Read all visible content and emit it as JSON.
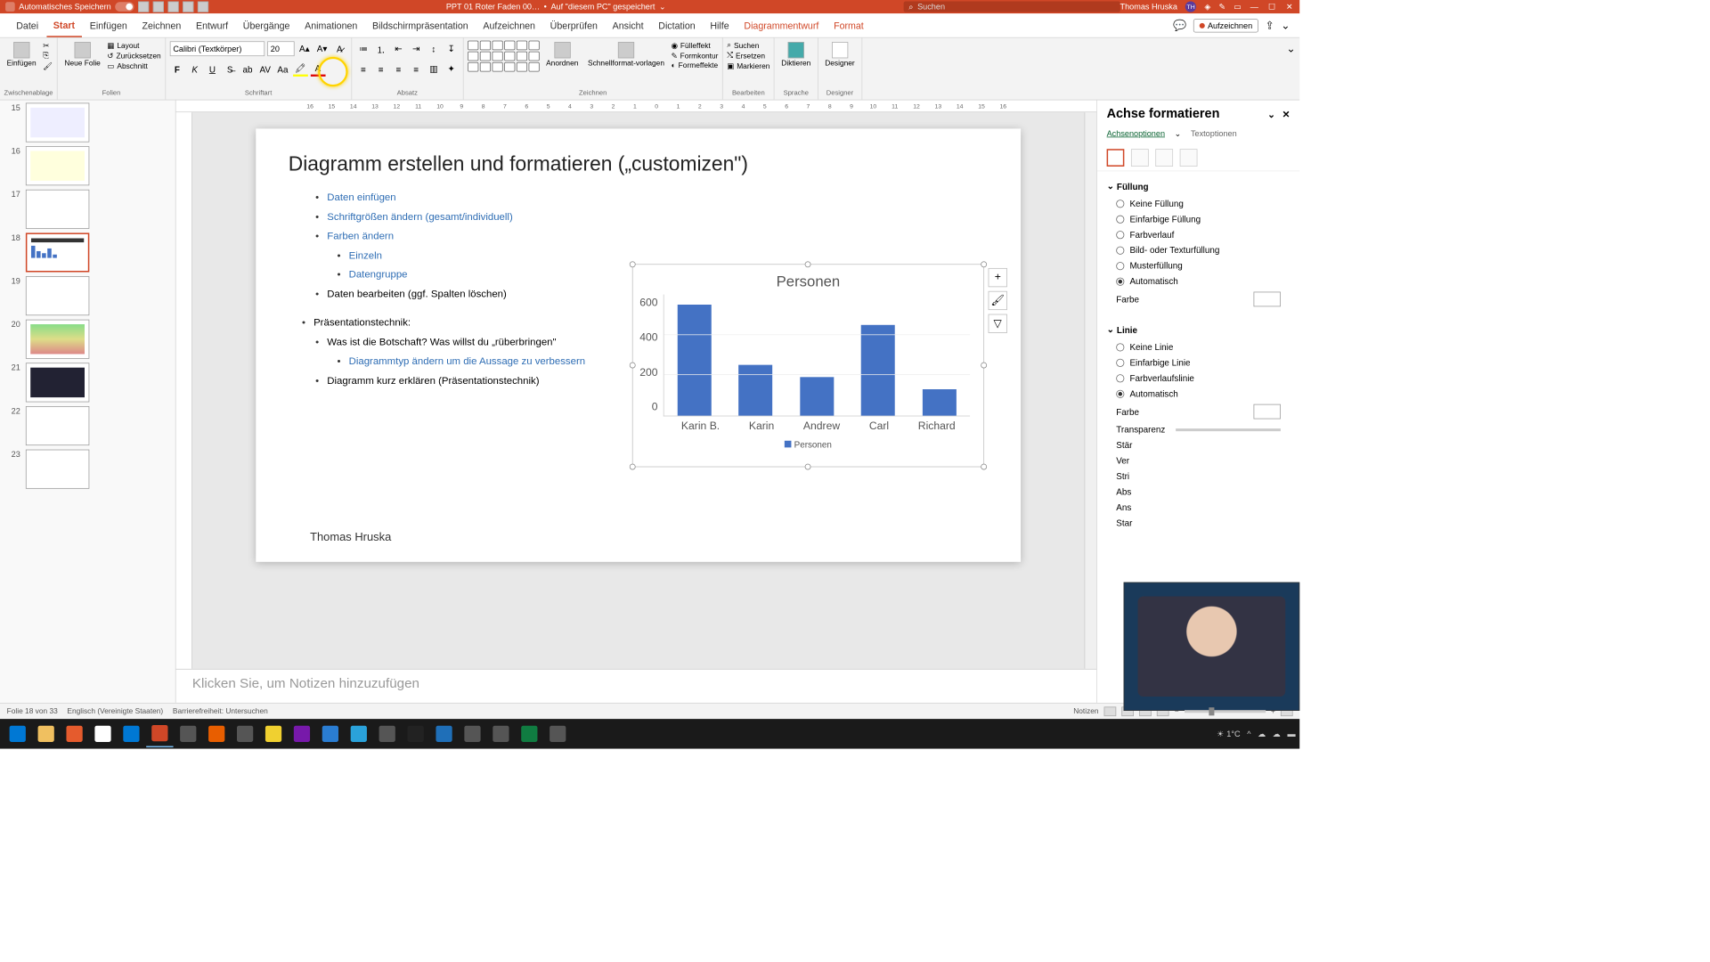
{
  "titlebar": {
    "autosave_label": "Automatisches Speichern",
    "doc_title": "PPT 01 Roter Faden 00…",
    "saved_status": "Auf \"diesem PC\" gespeichert",
    "search_placeholder": "Suchen",
    "user_name": "Thomas Hruska",
    "user_initials": "TH"
  },
  "tabs": {
    "datei": "Datei",
    "start": "Start",
    "einfugen": "Einfügen",
    "zeichnen": "Zeichnen",
    "entwurf": "Entwurf",
    "ubergange": "Übergänge",
    "animationen": "Animationen",
    "bildschirm": "Bildschirmpräsentation",
    "aufzeichnen": "Aufzeichnen",
    "uberprufen": "Überprüfen",
    "ansicht": "Ansicht",
    "dictation": "Dictation",
    "hilfe": "Hilfe",
    "diagrammentwurf": "Diagrammentwurf",
    "format": "Format",
    "aufzeichnen_btn": "Aufzeichnen"
  },
  "ribbon": {
    "einfugen": "Einfügen",
    "zwischenablage": "Zwischenablage",
    "neue_folie": "Neue Folie",
    "layout": "Layout",
    "zurucksetzen": "Zurücksetzen",
    "abschnitt": "Abschnitt",
    "folien": "Folien",
    "font_name": "Calibri (Textkörper)",
    "font_size": "20",
    "schriftart": "Schriftart",
    "absatz": "Absatz",
    "anordnen": "Anordnen",
    "schnellformat": "Schnellformat-vorlagen",
    "fulleffekt": "Fülleffekt",
    "formkontur": "Formkontur",
    "formeffekte": "Formeffekte",
    "zeichnen": "Zeichnen",
    "suchen": "Suchen",
    "ersetzen": "Ersetzen",
    "markieren": "Markieren",
    "bearbeiten": "Bearbeiten",
    "diktieren": "Diktieren",
    "sprache": "Sprache",
    "designer": "Designer",
    "designer_label": "Designer"
  },
  "slide": {
    "title": "Diagramm erstellen und formatieren („customizen\")",
    "bullets": {
      "b1": "Daten einfügen",
      "b2": "Schriftgrößen ändern (gesamt/individuell)",
      "b3": "Farben ändern",
      "b3a": "Einzeln",
      "b3b": "Datengruppe",
      "b4": "Daten bearbeiten (ggf. Spalten löschen)",
      "b5": "Präsentationstechnik:",
      "b5a": "Was ist die Botschaft? Was willst du „rüberbringen\"",
      "b5a1": "Diagrammtyp ändern um die Aussage zu verbessern",
      "b5b": "Diagramm kurz erklären (Präsentationstechnik)"
    },
    "author": "Thomas Hruska"
  },
  "chart_data": {
    "type": "bar",
    "title": "Personen",
    "categories": [
      "Karin B.",
      "Karin",
      "Andrew",
      "Carl",
      "Richard"
    ],
    "values": [
      550,
      250,
      190,
      450,
      130
    ],
    "y_ticks": [
      "600",
      "400",
      "200",
      "0"
    ],
    "ylim": [
      0,
      600
    ],
    "legend": "Personen"
  },
  "thumbs": {
    "t15": "15",
    "t16": "16",
    "t17": "17",
    "t18": "18",
    "t19": "19",
    "t20": "20",
    "t21": "21",
    "t22": "22",
    "t23": "23"
  },
  "format_pane": {
    "title": "Achse formatieren",
    "tab_options": "Achsenoptionen",
    "tab_text": "Textoptionen",
    "fill_title": "Füllung",
    "fill_none": "Keine Füllung",
    "fill_solid": "Einfarbige Füllung",
    "fill_gradient": "Farbverlauf",
    "fill_picture": "Bild- oder Texturfüllung",
    "fill_pattern": "Musterfüllung",
    "fill_auto": "Automatisch",
    "color_label": "Farbe",
    "line_title": "Linie",
    "line_none": "Keine Linie",
    "line_solid": "Einfarbige Linie",
    "line_gradient": "Farbverlaufslinie",
    "line_auto": "Automatisch",
    "transparenz": "Transparenz",
    "starke": "Stär",
    "verbund": "Ver",
    "strich": "Stri",
    "abschluss": "Abs",
    "anschluss": "Ans",
    "start": "Star"
  },
  "notes": {
    "placeholder": "Klicken Sie, um Notizen hinzuzufügen"
  },
  "statusbar": {
    "slide_count": "Folie 18 von 33",
    "language": "Englisch (Vereinigte Staaten)",
    "accessibility": "Barrierefreiheit: Untersuchen",
    "notizen": "Notizen"
  },
  "taskbar": {
    "weather": "1°C"
  },
  "ruler_h": [
    "16",
    "15",
    "14",
    "13",
    "12",
    "11",
    "10",
    "9",
    "8",
    "7",
    "6",
    "5",
    "4",
    "3",
    "2",
    "1",
    "0",
    "1",
    "2",
    "3",
    "4",
    "5",
    "6",
    "7",
    "8",
    "9",
    "10",
    "11",
    "12",
    "13",
    "14",
    "15",
    "16"
  ]
}
